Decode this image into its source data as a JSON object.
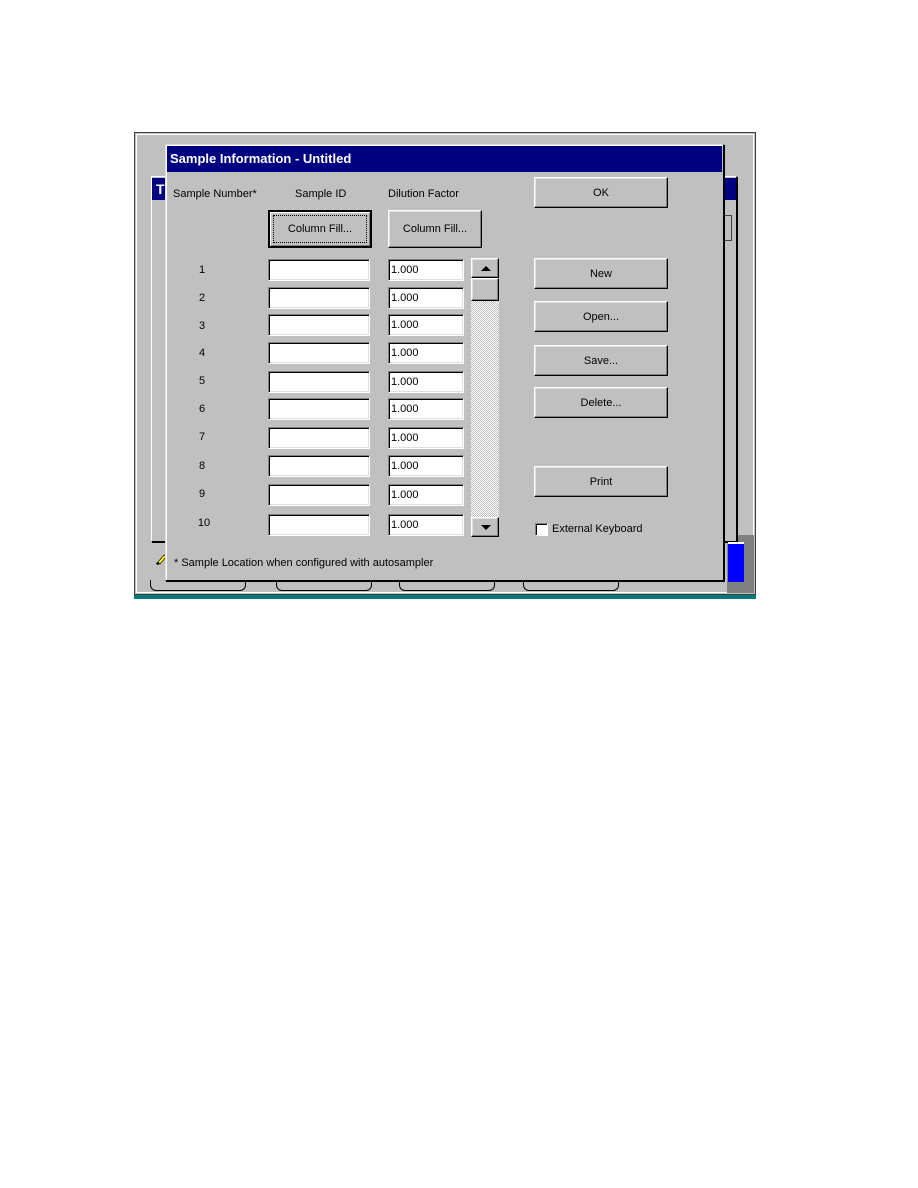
{
  "background_window": {
    "title_initial": "T"
  },
  "dialog": {
    "title": "Sample Information - Untitled",
    "headers": {
      "sample_number": "Sample Number*",
      "sample_id": "Sample ID",
      "dilution_factor": "Dilution Factor"
    },
    "column_fill_sample_id": "Column Fill...",
    "column_fill_dilution": "Column Fill...",
    "rows": [
      {
        "number": "1",
        "sample_id": "",
        "dilution": "1.000"
      },
      {
        "number": "2",
        "sample_id": "",
        "dilution": "1.000"
      },
      {
        "number": "3",
        "sample_id": "",
        "dilution": "1.000"
      },
      {
        "number": "4",
        "sample_id": "",
        "dilution": "1.000"
      },
      {
        "number": "5",
        "sample_id": "",
        "dilution": "1.000"
      },
      {
        "number": "6",
        "sample_id": "",
        "dilution": "1.000"
      },
      {
        "number": "7",
        "sample_id": "",
        "dilution": "1.000"
      },
      {
        "number": "8",
        "sample_id": "",
        "dilution": "1.000"
      },
      {
        "number": "9",
        "sample_id": "",
        "dilution": "1.000"
      },
      {
        "number": "10",
        "sample_id": "",
        "dilution": "1.000"
      }
    ],
    "buttons": {
      "ok": "OK",
      "new": "New",
      "open": "Open...",
      "save": "Save...",
      "delete": "Delete...",
      "print": "Print"
    },
    "external_keyboard": {
      "label": "External Keyboard",
      "checked": false
    },
    "footnote": "* Sample Location when configured with autosampler"
  },
  "colors": {
    "title_bar": "#000080",
    "face": "#c0c0c0",
    "accent_blue": "#0000ff",
    "teal": "#007a7a"
  }
}
